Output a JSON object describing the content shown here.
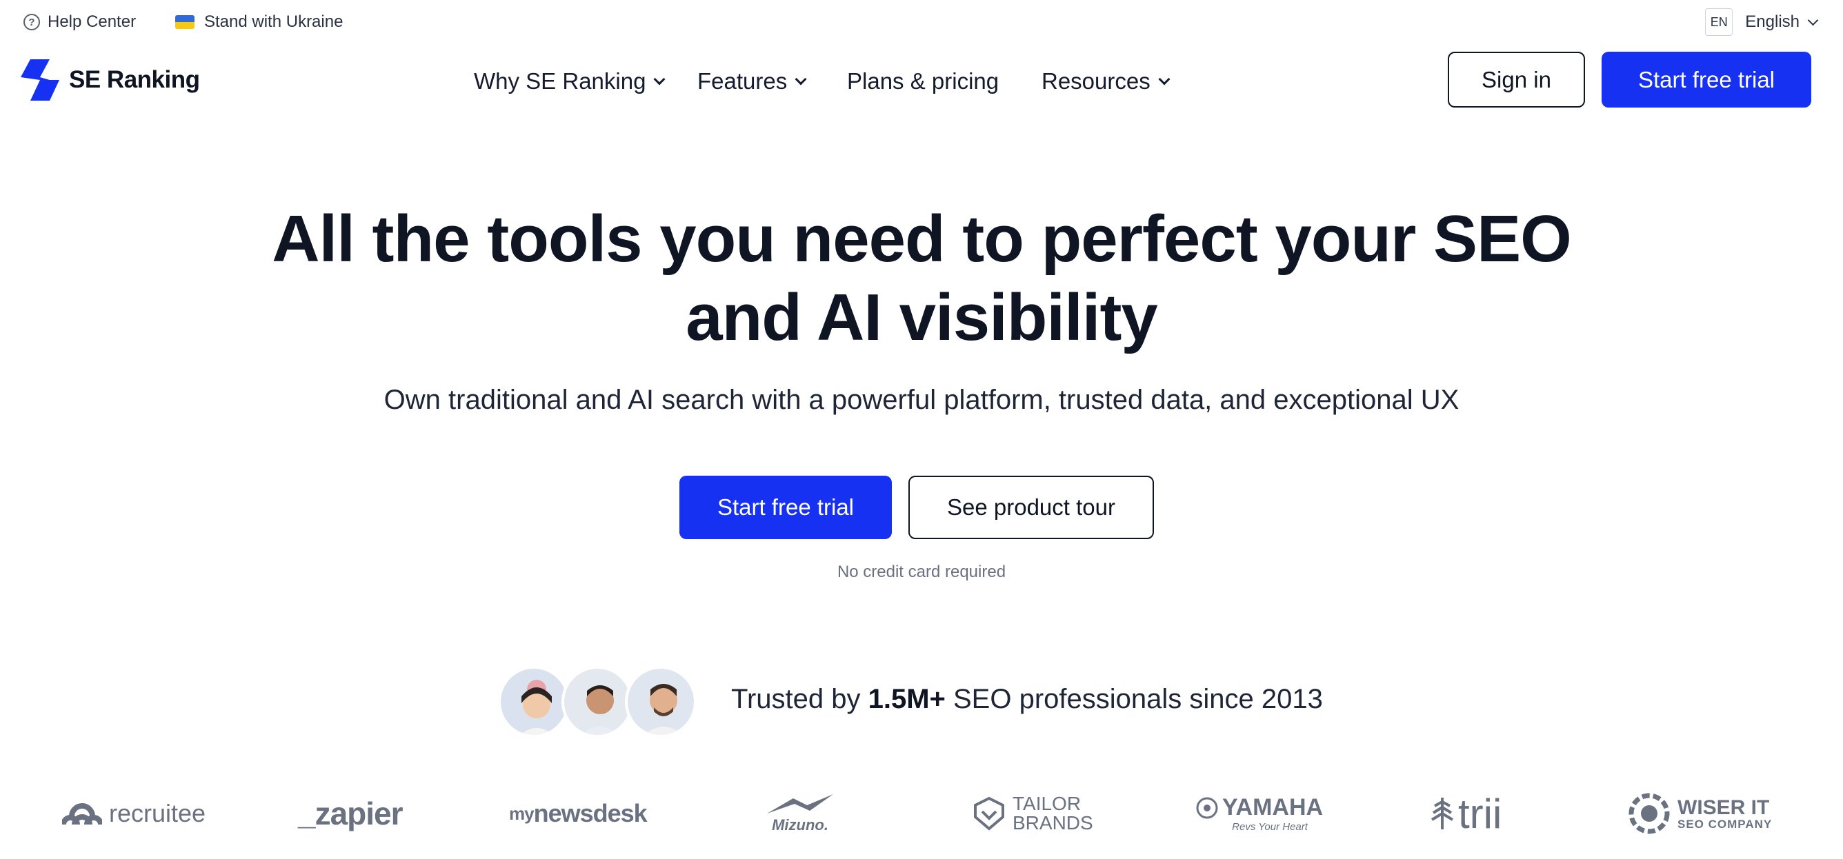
{
  "topbar": {
    "help_label": "Help Center",
    "ukraine_label": "Stand with Ukraine",
    "lang_code": "EN",
    "lang_label": "English"
  },
  "nav": {
    "brand": "SE Ranking",
    "items": [
      {
        "label": "Why SE Ranking",
        "has_dropdown": true
      },
      {
        "label": "Features",
        "has_dropdown": true
      },
      {
        "label": "Plans & pricing",
        "has_dropdown": false
      },
      {
        "label": "Resources",
        "has_dropdown": true
      }
    ],
    "signin_label": "Sign in",
    "trial_label": "Start free trial"
  },
  "hero": {
    "headline_line1": "All the tools you need to perfect your SEO",
    "headline_line2": "and AI visibility",
    "subheadline": "Own traditional and AI search with a powerful platform, trusted data, and exceptional UX",
    "primary_cta": "Start free trial",
    "secondary_cta": "See product tour",
    "note": "No credit card required"
  },
  "trust": {
    "prefix": "Trusted by ",
    "highlight": "1.5M+",
    "suffix": " SEO professionals since 2013"
  },
  "logos": {
    "recruitee": "recruitee",
    "zapier": "_zapier",
    "mynewsdesk_my": "my",
    "mynewsdesk_main": "newsdesk",
    "mizuno": "Mizuno.",
    "tailor_1": "TAILOR",
    "tailor_2": "BRANDS",
    "yamaha": "YAMAHA",
    "yamaha_tag": "Revs Your Heart",
    "trii": "trii",
    "wiser_1": "WISER IT",
    "wiser_2": "SEO COMPANY"
  },
  "colors": {
    "accent": "#1631f2",
    "text_dark": "#0f1523",
    "muted": "#6b7080",
    "logo_gray": "#6a7180",
    "flag_blue": "#2f6bd6",
    "flag_yellow": "#f6c814"
  },
  "icons": {
    "help": "question-circle-icon",
    "flag": "ukraine-flag-icon",
    "chevron": "chevron-down-icon"
  }
}
